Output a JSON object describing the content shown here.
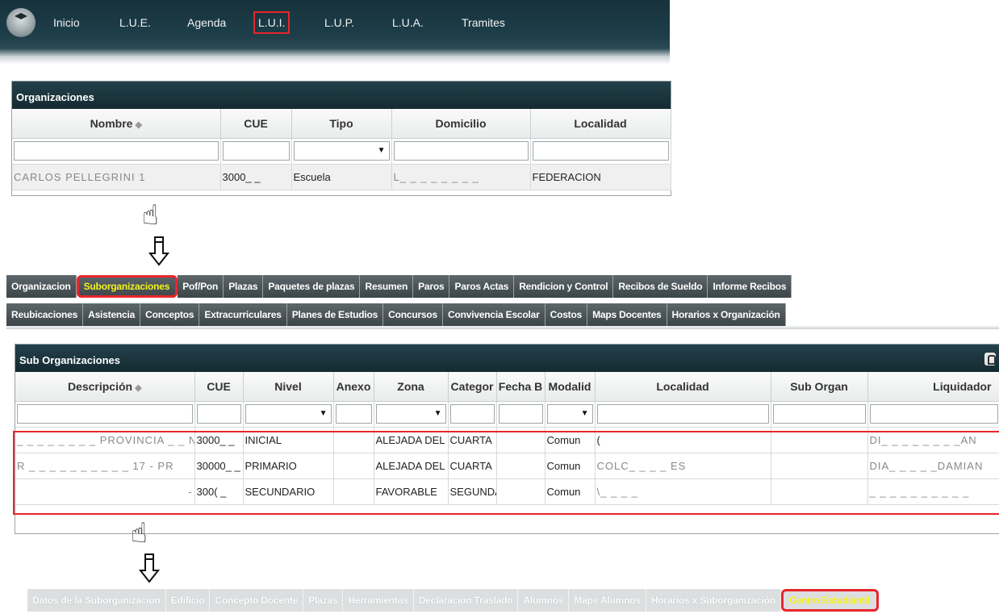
{
  "topnav": {
    "items": [
      {
        "label": "Inicio"
      },
      {
        "label": "L.U.E."
      },
      {
        "label": "Agenda"
      },
      {
        "label": "L.U.I."
      },
      {
        "label": "L.U.P."
      },
      {
        "label": "L.U.A."
      },
      {
        "label": "Tramites"
      }
    ],
    "active": "L.U.I."
  },
  "organizaciones": {
    "title": "Organizaciones",
    "columns": [
      "Nombre",
      "CUE",
      "Tipo",
      "Domicilio",
      "Localidad"
    ],
    "rows": [
      {
        "nombre": "CARLOS PELLEGRINI 1",
        "cue": "3000_ _",
        "tipo": "Escuela",
        "domicilio": "L_ _ _ _ _ _ _ _",
        "localidad": "FEDERACION"
      }
    ]
  },
  "tabs_org": {
    "row1": [
      "Organizacion",
      "Suborganizaciones",
      "Pof/Pon",
      "Plazas",
      "Paquetes de plazas",
      "Resumen",
      "Paros",
      "Paros Actas",
      "Rendicion y Control",
      "Recibos de Sueldo",
      "Informe Recibos"
    ],
    "row2": [
      "Reubicaciones",
      "Asistencia",
      "Conceptos",
      "Extracurriculares",
      "Planes de Estudios",
      "Concursos",
      "Convivencia Escolar",
      "Costos",
      "Maps Docentes",
      "Horarios x Organización"
    ],
    "selected": "Suborganizaciones"
  },
  "suborganizaciones": {
    "title": "Sub Organizaciones",
    "columns": [
      "Descripción",
      "CUE",
      "Nivel",
      "Anexo",
      "Zona",
      "Categor",
      "Fecha B",
      "Modalid",
      "Localidad",
      "Sub Organ",
      "Liquidador"
    ],
    "rows": [
      {
        "descripcion": "_ _ _ _ _ _ _ _ PROVINCIA _ _ NI",
        "cue": "3000_ _",
        "nivel": "INICIAL",
        "anexo": "",
        "zona": "ALEJADA DEL R",
        "categoria": "CUARTA",
        "fecha_b": "",
        "modalidad": "Comun",
        "localidad": "(",
        "sub_organ": "",
        "liquidador": "DI_ _ _ _ _ _ _ _AN"
      },
      {
        "descripcion": "R _ _ _ _ _ _ _ _ _ _ 17 - PR",
        "cue": "30000_ _",
        "nivel": "PRIMARIO",
        "anexo": "",
        "zona": "ALEJADA DEL R",
        "categoria": "CUARTA",
        "fecha_b": "",
        "modalidad": "Comun",
        "localidad": "COLC_ _ _ _ ES",
        "sub_organ": "",
        "liquidador": "DIA_ _ _ _ _DAMIAN"
      },
      {
        "descripcion": "-",
        "cue": "300( _",
        "nivel": "SECUNDARIO",
        "anexo": "",
        "zona": "FAVORABLE",
        "categoria": "SEGUNDA",
        "fecha_b": "",
        "modalidad": "Comun",
        "localidad": "\\_ _ _ _",
        "sub_organ": "",
        "liquidador": "_ _ _ _ _ _ _ _ _ _"
      }
    ]
  },
  "tabs_suborg": {
    "items": [
      "Datos de la Suborganizacion",
      "Edificio",
      "Concepto Docente",
      "Plazas",
      "Herramientas",
      "Declaracion Traslado",
      "Alumnos",
      "Maps Alumnos",
      "Horarios x Suborganización",
      "Centro Estudiantil"
    ],
    "selected": "Centro Estudiantil"
  },
  "colors": {
    "highlight_red": "#e8262b",
    "selected_tab_text": "#f5f31c",
    "header_dark": "#152a31"
  }
}
